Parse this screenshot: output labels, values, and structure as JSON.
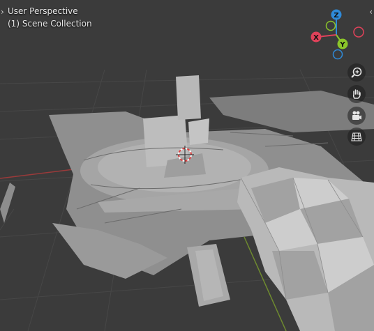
{
  "viewport": {
    "title": "User Perspective",
    "collection": "(1) Scene Collection"
  },
  "gizmo": {
    "x_label": "X",
    "y_label": "Y",
    "z_label": "Z",
    "colors": {
      "x": "#e0425a",
      "y": "#8bc52a",
      "z": "#2f8ad8"
    }
  },
  "nav_buttons": [
    {
      "icon": "zoom-in-icon"
    },
    {
      "icon": "hand-icon"
    },
    {
      "icon": "camera-icon"
    },
    {
      "icon": "grid-icon"
    }
  ]
}
